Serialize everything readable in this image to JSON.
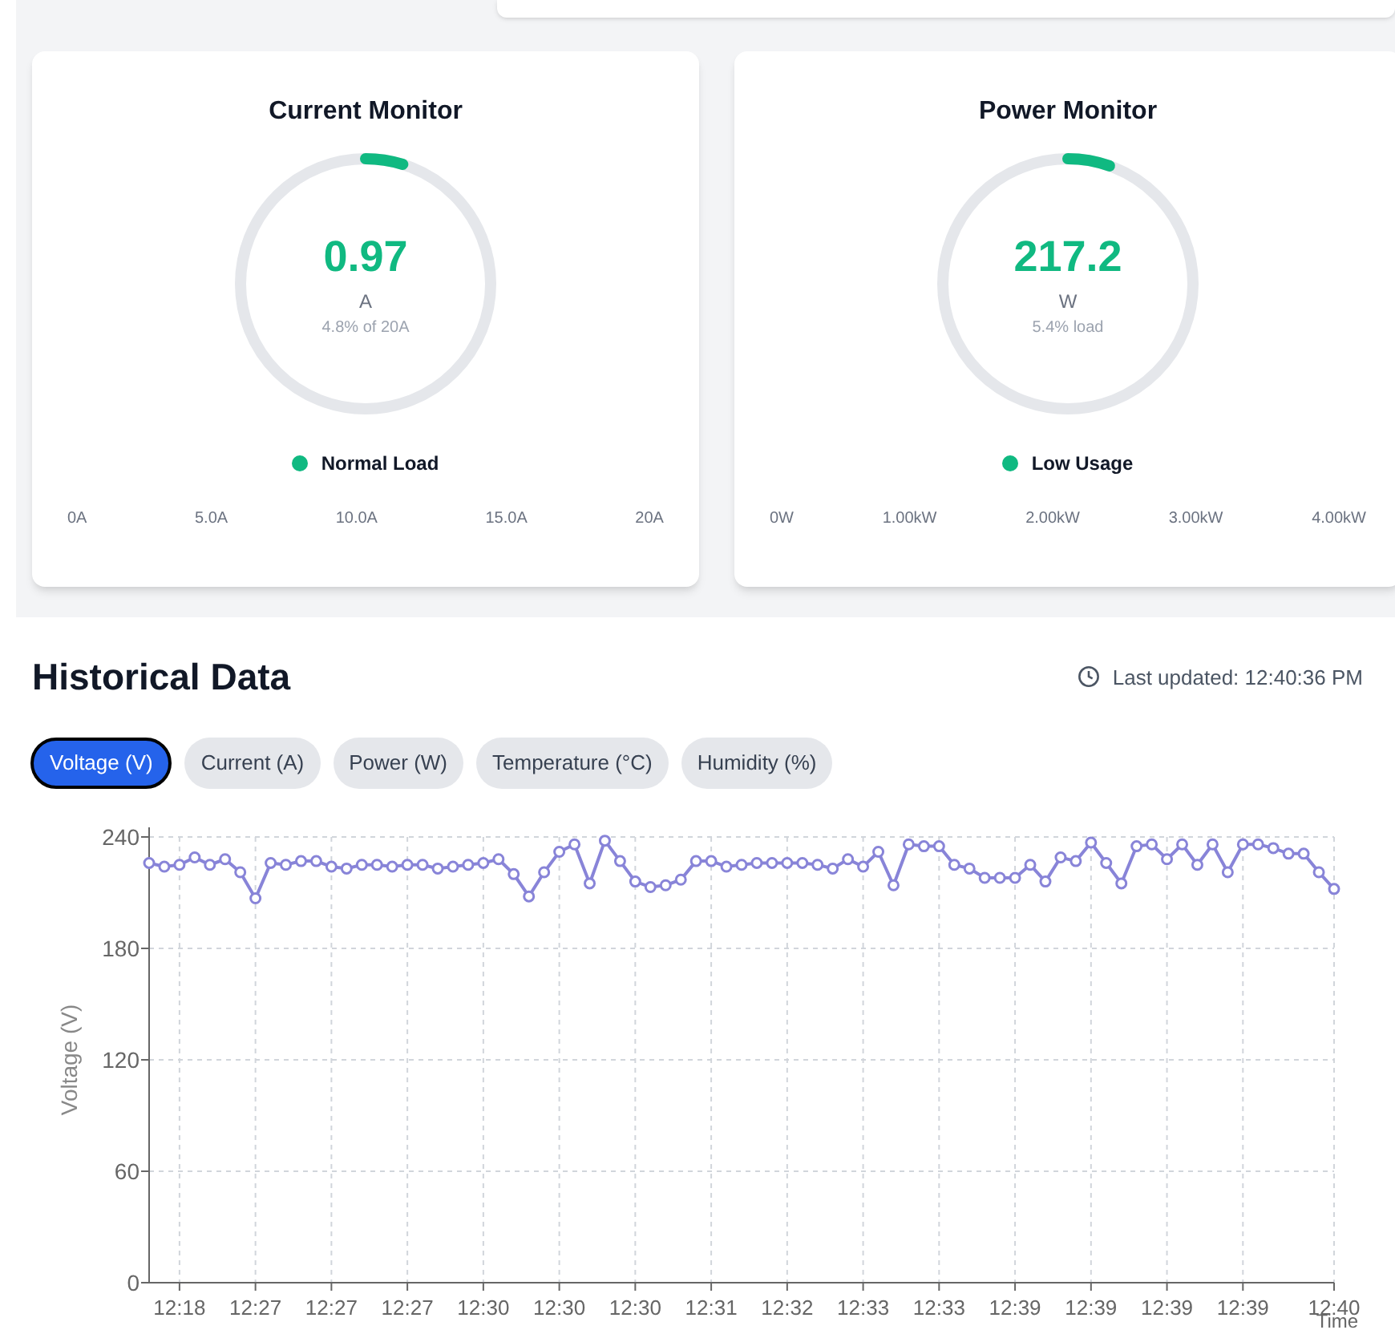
{
  "monitors": [
    {
      "title": "Current Monitor",
      "value": "0.97",
      "unit": "A",
      "detail": "4.8% of 20A",
      "level": 0.048,
      "status": "Normal Load",
      "color": "#10b981",
      "scale": [
        "0A",
        "5.0A",
        "10.0A",
        "15.0A",
        "20A"
      ]
    },
    {
      "title": "Power Monitor",
      "value": "217.2",
      "unit": "W",
      "detail": "5.4% load",
      "level": 0.054,
      "status": "Low Usage",
      "color": "#10b981",
      "scale": [
        "0W",
        "1.00kW",
        "2.00kW",
        "3.00kW",
        "4.00kW"
      ]
    }
  ],
  "historical": {
    "title": "Historical Data",
    "last_updated": "Last updated: 12:40:36 PM",
    "tabs": [
      {
        "label": "Voltage (V)",
        "selected": true
      },
      {
        "label": "Current (A)",
        "selected": false
      },
      {
        "label": "Power (W)",
        "selected": false
      },
      {
        "label": "Temperature (°C)",
        "selected": false
      },
      {
        "label": "Humidity (%)",
        "selected": false
      }
    ],
    "chart_data": {
      "type": "line",
      "grid": true,
      "marker": true,
      "xlabel": "Time",
      "ylabel": "Voltage (V)",
      "ylim": [
        0,
        240
      ],
      "yticks": [
        0,
        60,
        120,
        180,
        240
      ],
      "categories": [
        null,
        null,
        "12:18",
        null,
        null,
        null,
        null,
        "12:27",
        null,
        null,
        null,
        null,
        "12:27",
        null,
        null,
        null,
        null,
        "12:27",
        null,
        null,
        null,
        null,
        "12:30",
        null,
        null,
        null,
        null,
        "12:30",
        null,
        null,
        null,
        null,
        "12:30",
        null,
        null,
        null,
        null,
        "12:31",
        null,
        null,
        null,
        null,
        "12:32",
        null,
        null,
        null,
        null,
        "12:33",
        null,
        null,
        null,
        null,
        "12:33",
        null,
        null,
        null,
        null,
        "12:39",
        null,
        null,
        null,
        null,
        "12:39",
        null,
        null,
        null,
        null,
        "12:39",
        null,
        null,
        null,
        null,
        "12:39",
        null,
        null,
        null,
        null,
        null,
        "12:40"
      ],
      "values": [
        226,
        224,
        225,
        229,
        225,
        228,
        221,
        207,
        226,
        225,
        227,
        227,
        224,
        223,
        225,
        225,
        224,
        225,
        225,
        223,
        224,
        225,
        226,
        228,
        220,
        208,
        221,
        232,
        236,
        215,
        238,
        227,
        216,
        213,
        214,
        217,
        227,
        227,
        224,
        225,
        226,
        226,
        226,
        226,
        225,
        223,
        228,
        224,
        232,
        214,
        236,
        235,
        235,
        225,
        223,
        218,
        218,
        218,
        225,
        216,
        229,
        227,
        237,
        226,
        215,
        235,
        236,
        228,
        236,
        225,
        236,
        221,
        236,
        236,
        234,
        231,
        231,
        221,
        212
      ],
      "color": "#8884d8"
    }
  }
}
